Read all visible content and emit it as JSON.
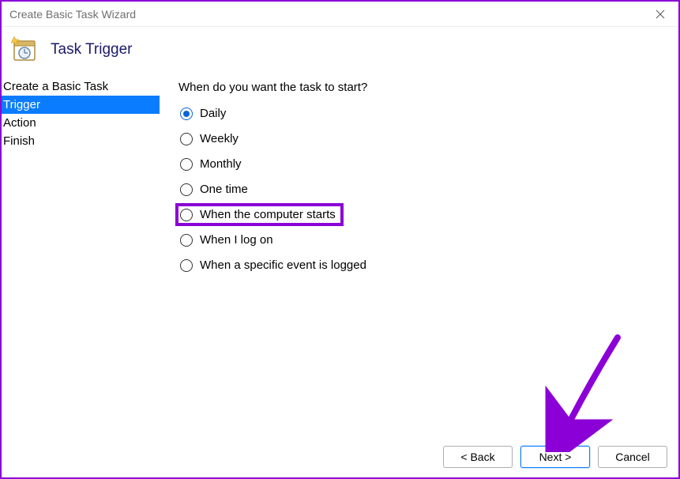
{
  "window": {
    "title": "Create Basic Task Wizard"
  },
  "header": {
    "title": "Task Trigger"
  },
  "sidebar": {
    "steps": [
      {
        "label": "Create a Basic Task"
      },
      {
        "label": "Trigger"
      },
      {
        "label": "Action"
      },
      {
        "label": "Finish"
      }
    ],
    "active_index": 1
  },
  "main": {
    "prompt": "When do you want the task to start?",
    "options": [
      {
        "label": "Daily"
      },
      {
        "label": "Weekly"
      },
      {
        "label": "Monthly"
      },
      {
        "label": "One time"
      },
      {
        "label": "When the computer starts"
      },
      {
        "label": "When I log on"
      },
      {
        "label": "When a specific event is logged"
      }
    ],
    "selected_index": 0,
    "highlight_index": 4
  },
  "footer": {
    "back": "< Back",
    "next": "Next >",
    "cancel": "Cancel"
  },
  "annotation": {
    "arrow_color": "#8b00d6"
  }
}
